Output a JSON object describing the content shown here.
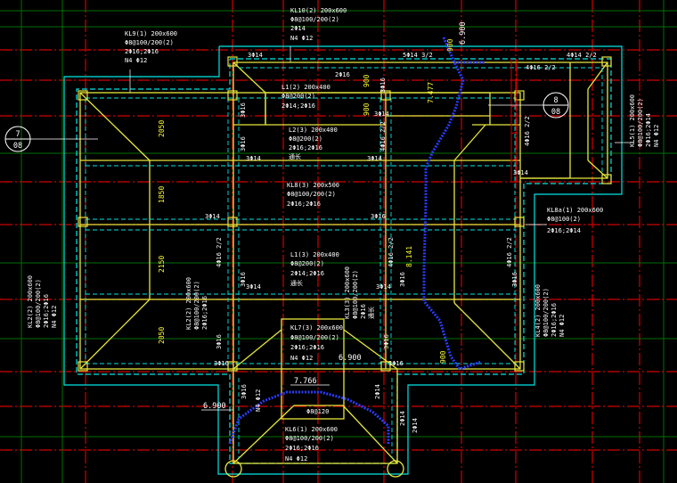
{
  "colors": {
    "background": "#000000",
    "grid_red": "#d00000",
    "grid_green": "#006f00",
    "outline_cyan": "#00e5e5",
    "beam_yellow": "#e6e63c",
    "rebar_blue": "#2a3cff",
    "text_white": "#ffffff",
    "text_yellow": "#ffff33"
  },
  "axes": {
    "axis7": {
      "num": "7",
      "ref": "08"
    },
    "axis8": {
      "num": "8",
      "ref": "08"
    }
  },
  "beams": {
    "kl9": {
      "lines": [
        "KL9(1) 200x600",
        "Φ8@100/200(2)",
        "2Φ16;2Φ16",
        "N4 Φ12"
      ]
    },
    "kl10": {
      "lines": [
        "KL10(2) 200x600",
        "Φ8@100/200(2)",
        "2Φ14",
        "N4 Φ12"
      ]
    },
    "kl5": {
      "lines": [
        "KL5(1) 200x600",
        "Φ8@100/200(2)",
        "2Φ16;2Φ14",
        "N4 Φ12"
      ]
    },
    "kl8a": {
      "lines": [
        "KL8a(1) 200x600",
        "Φ8@100(2)",
        "2Φ16;2Φ14"
      ]
    },
    "kl8": {
      "lines": [
        "KL8(3) 200x500",
        "Φ8@100/200(2)",
        "2Φ16;2Φ16"
      ]
    },
    "l1": {
      "lines": [
        "L1(2) 200x400",
        "Φ8@200(2)",
        "2Φ14;2Φ16"
      ]
    },
    "l2": {
      "lines": [
        "L2(3) 200x400",
        "Φ8@200(2)",
        "2Φ16;2Φ16",
        "通长"
      ]
    },
    "l1b": {
      "lines": [
        "L1(3) 200x400",
        "Φ8@200(2)",
        "2Φ14;2Φ16",
        "通长"
      ]
    },
    "kl2": {
      "lines": [
        "KL2(2) 200x600",
        "Φ8@100/200(2)",
        "2Φ16;2Φ16",
        "N4 Φ12"
      ]
    },
    "kl4": {
      "lines": [
        "KL4(2) 200x600",
        "Φ8@100/200(2)",
        "2Φ16;2Φ16",
        "N4 Φ12"
      ]
    },
    "kl3": {
      "lines": [
        "KL3(3) 200x600",
        "Φ8@100/200(2)",
        "2Φ16",
        "通长"
      ]
    },
    "kl7": {
      "lines": [
        "KL7(3) 200x600",
        "Φ8@100/200(2)",
        "2Φ16;2Φ16",
        "N4 Φ12"
      ]
    },
    "kl6": {
      "lines": [
        "KL6(1) 200x600",
        "Φ8@100/200(2)",
        "2Φ16;2Φ16",
        "N4 Φ12"
      ]
    },
    "kl2b": {
      "lines": [
        "KL2(2) 200x600",
        "Φ8@100/200(2)",
        "2Φ16;2Φ16"
      ]
    }
  },
  "rebar_labels": [
    "3Φ14",
    "5Φ14  3/2",
    "4Φ14  2/2",
    "2Φ16",
    "3Φ16",
    "3Φ16",
    "3Φ14",
    "3Φ16",
    "4Φ16  2/2",
    "3Φ14",
    "4Φ16  2/2",
    "3Φ14",
    "3Φ14",
    "3Φ16",
    "4Φ16  2/2",
    "4Φ16  2/2",
    "3Φ16",
    "3Φ16",
    "3Φ16",
    "3Φ16",
    "3Φ14",
    "3Φ16",
    "2Φ14",
    "3Φ16",
    "3Φ14",
    "3Φ16",
    "4Φ16  2/2",
    "4Φ16  2/2",
    "Φ8@120",
    "N4 Φ12",
    "3Φ16",
    "2Φ14",
    "2Φ14",
    "3Φ14"
  ],
  "dimensions": {
    "d2050a": "2050",
    "d1850": "1850",
    "d2150": "2150",
    "d2050b": "2050",
    "d900a": "900",
    "d900b": "900",
    "d900c": "900",
    "d900d": "900",
    "slope": "7.477",
    "slope2": "8.141"
  },
  "elevations": {
    "e6900a": "6.900",
    "e6900b": "6.900",
    "e6900c": "6.900",
    "e7766": "7.766"
  }
}
